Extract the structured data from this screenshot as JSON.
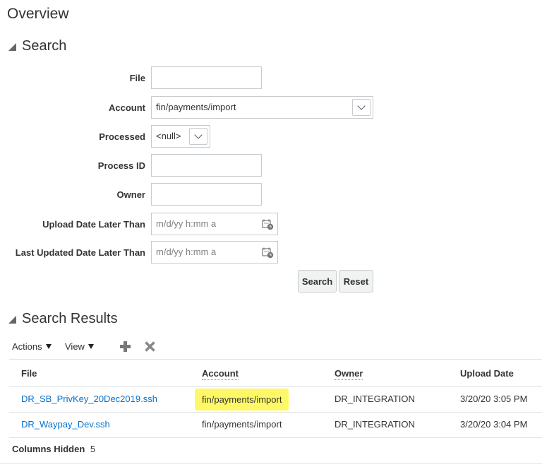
{
  "page": {
    "title": "Overview"
  },
  "search": {
    "title": "Search",
    "fields": {
      "file": {
        "label": "File",
        "value": ""
      },
      "account": {
        "label": "Account",
        "value": "fin/payments/import"
      },
      "processed": {
        "label": "Processed",
        "value": "<null>"
      },
      "process_id": {
        "label": "Process ID",
        "value": ""
      },
      "owner": {
        "label": "Owner",
        "value": ""
      },
      "upload_date": {
        "label": "Upload Date Later Than",
        "placeholder": "m/d/yy h:mm a"
      },
      "last_updated": {
        "label": "Last Updated Date Later Than",
        "placeholder": "m/d/yy h:mm a"
      }
    },
    "buttons": {
      "search": "Search",
      "reset": "Reset"
    }
  },
  "results": {
    "title": "Search Results",
    "toolbar": {
      "actions": "Actions",
      "view": "View",
      "add_icon": "plus-icon",
      "delete_icon": "x-icon"
    },
    "columns": {
      "file": "File",
      "account": "Account",
      "owner": "Owner",
      "upload_date": "Upload Date"
    },
    "rows": [
      {
        "file": "DR_SB_PrivKey_20Dec2019.ssh",
        "account": "fin/payments/import",
        "owner": "DR_INTEGRATION",
        "upload_date": "3/20/20 3:05 PM"
      },
      {
        "file": "DR_Waypay_Dev.ssh",
        "account": "fin/payments/import",
        "owner": "DR_INTEGRATION",
        "upload_date": "3/20/20 3:04 PM"
      }
    ],
    "footer": {
      "label": "Columns Hidden",
      "count": "5"
    }
  },
  "colors": {
    "link": "#0572ce",
    "highlight": "#fff866",
    "border": "#c7cbcf",
    "button_bg": "#f1f3f3"
  }
}
